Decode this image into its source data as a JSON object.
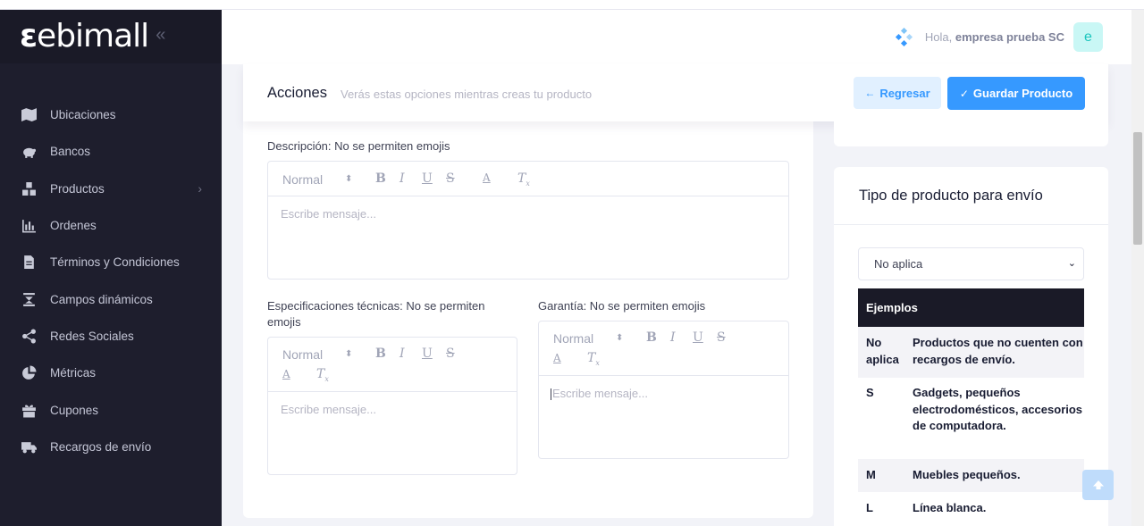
{
  "brand": {
    "logo_text": "ebimall",
    "logo_prefix": "ε"
  },
  "sidebar": {
    "items": [
      {
        "label": "Ubicaciones",
        "icon": "map-icon"
      },
      {
        "label": "Bancos",
        "icon": "piggy-bank-icon"
      },
      {
        "label": "Productos",
        "icon": "boxes-icon",
        "has_children": true
      },
      {
        "label": "Ordenes",
        "icon": "bar-chart-icon"
      },
      {
        "label": "Términos y Condiciones",
        "icon": "document-icon"
      },
      {
        "label": "Campos dinámicos",
        "icon": "fields-icon"
      },
      {
        "label": "Redes Sociales",
        "icon": "share-icon"
      },
      {
        "label": "Métricas",
        "icon": "pie-chart-icon"
      },
      {
        "label": "Cupones",
        "icon": "gift-icon"
      },
      {
        "label": "Recargos de envío",
        "icon": "truck-icon"
      }
    ]
  },
  "header": {
    "greeting": "Hola,",
    "user_name": "empresa prueba SC",
    "avatar_letter": "e"
  },
  "actions": {
    "title": "Acciones",
    "subtitle": "Verás estas opciones mientras creas tu producto",
    "back_label": "Regresar",
    "save_label": "Guardar Producto"
  },
  "form": {
    "description": {
      "label": "Descripción: No se permiten emojis",
      "format": "Normal",
      "placeholder": "Escribe mensaje..."
    },
    "specs": {
      "label": "Especificaciones técnicas: No se permiten emojis",
      "format": "Normal",
      "placeholder": "Escribe mensaje..."
    },
    "warranty": {
      "label": "Garantía: No se permiten emojis",
      "format": "Normal",
      "placeholder": "Escribe mensaje..."
    }
  },
  "shipping": {
    "title": "Tipo de producto para envío",
    "selected": "No aplica",
    "table_header": "Ejemplos",
    "rows": [
      {
        "key": "No aplica",
        "value": "Productos que no cuenten con recargos de envío."
      },
      {
        "key": "S",
        "value": "Gadgets, pequeños electrodomésticos, accesorios de computadora."
      },
      {
        "key": "M",
        "value": "Muebles pequeños."
      },
      {
        "key": "L",
        "value": "Línea blanca."
      }
    ]
  },
  "colors": {
    "sidebar_bg": "#1e1e2d",
    "primary": "#3699ff",
    "primary_light": "#e1f0ff",
    "table_head": "#1a1a27"
  }
}
